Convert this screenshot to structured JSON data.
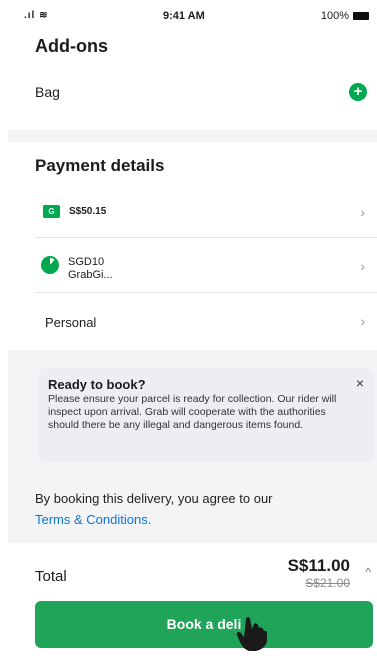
{
  "status_bar": {
    "signal": ".ıl ≋",
    "time": "9:41 AM",
    "battery": "100%"
  },
  "addons": {
    "title": "Add-ons",
    "item": "Bag",
    "add_symbol": "+"
  },
  "payment": {
    "title": "Payment details",
    "wallet": {
      "badge": "G",
      "amount": "S$50.15"
    },
    "gift": {
      "line1": "SGD10",
      "line2": "GrabGi..."
    },
    "profile": "Personal",
    "chevron": "›"
  },
  "notice": {
    "title": "Ready to book?",
    "body": "Please ensure your parcel is ready for collection. Our rider will inspect upon arrival. Grab will cooperate with the authorities should there be any illegal and dangerous items found.",
    "close": "×"
  },
  "agreement": {
    "text": "By booking this delivery, you agree to our",
    "link": "Terms & Conditions."
  },
  "summary": {
    "total_label": "Total",
    "price": "S$11.00",
    "old_price": "S$21.00",
    "caret": "^"
  },
  "action": {
    "book_label": "Book a deli"
  },
  "colors": {
    "brand_green": "#00a94f",
    "button_green": "#1fa45a",
    "link_blue": "#0f74d6"
  }
}
